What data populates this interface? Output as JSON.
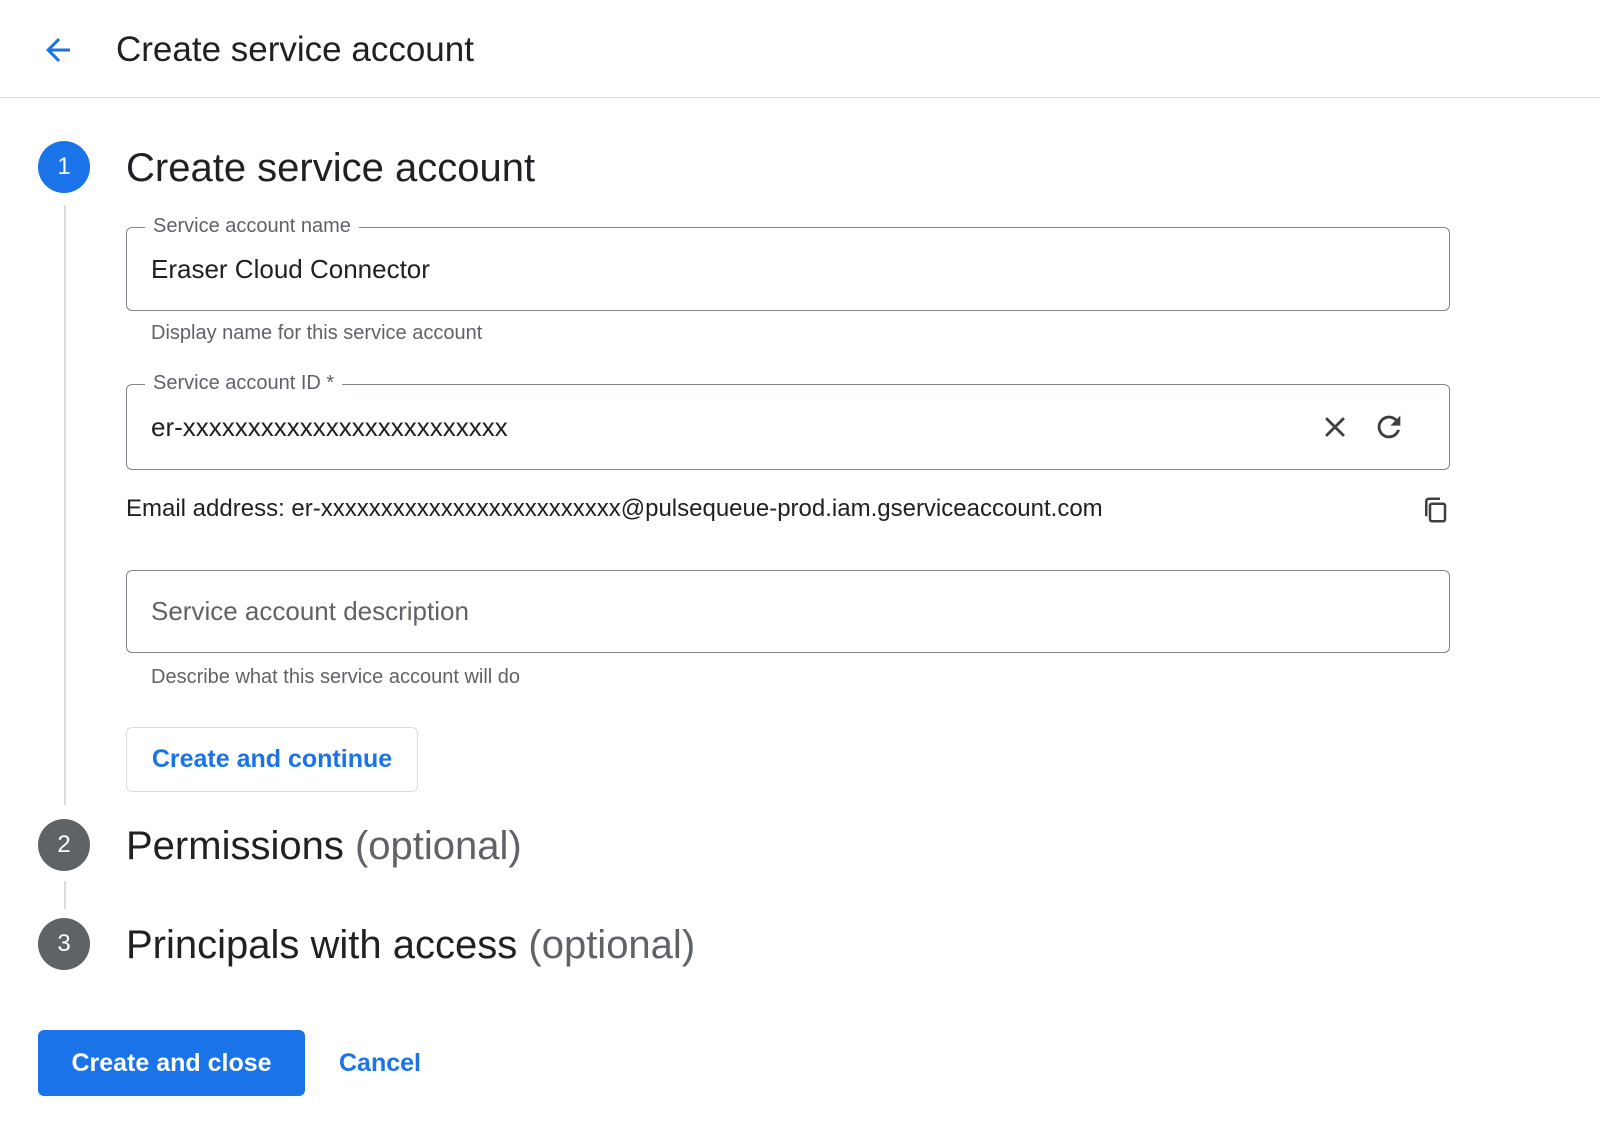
{
  "header": {
    "title": "Create service account",
    "back_icon": "arrow-back-icon"
  },
  "colors": {
    "accent": "#1a73e8",
    "inactive_step": "#5f6368",
    "text": "#202124",
    "secondary_text": "#5f6368",
    "border": "#80868b"
  },
  "steps": [
    {
      "number": "1",
      "title": "Create service account",
      "optional": "",
      "state": "active"
    },
    {
      "number": "2",
      "title": "Permissions",
      "optional": "(optional)",
      "state": "inactive"
    },
    {
      "number": "3",
      "title": "Principals with access",
      "optional": "(optional)",
      "state": "inactive"
    }
  ],
  "form": {
    "name": {
      "label": "Service account name",
      "value": "Eraser Cloud Connector",
      "helper": "Display name for this service account"
    },
    "id": {
      "label": "Service account ID *",
      "value": "er-xxxxxxxxxxxxxxxxxxxxxxxxx",
      "clear_icon": "close-icon",
      "refresh_icon": "refresh-icon"
    },
    "email": {
      "text": "Email address: er-xxxxxxxxxxxxxxxxxxxxxxxxx@pulsequeue-prod.iam.gserviceaccount.com",
      "copy_icon": "copy-icon"
    },
    "description": {
      "placeholder": "Service account description",
      "helper": "Describe what this service account will do"
    },
    "continue_label": "Create and continue"
  },
  "footer": {
    "primary_label": "Create and close",
    "cancel_label": "Cancel"
  }
}
